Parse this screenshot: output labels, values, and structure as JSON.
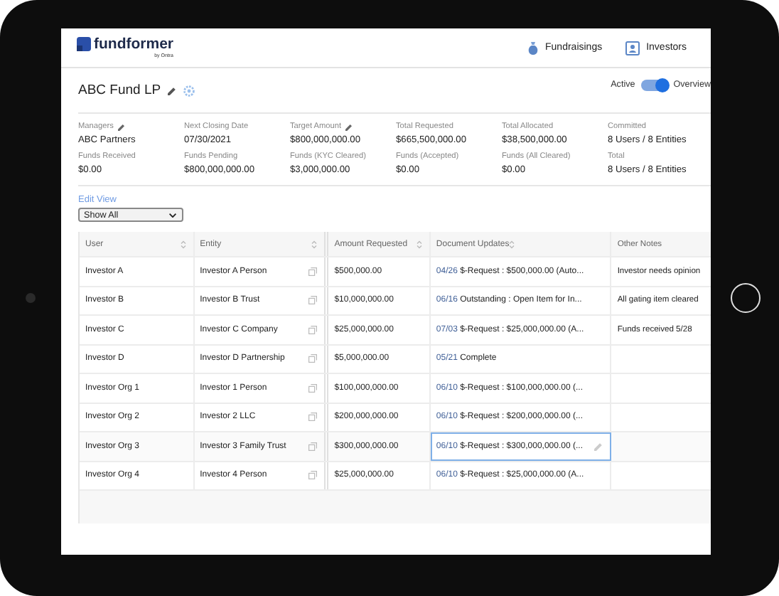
{
  "header": {
    "logo": {
      "name": "fundformer",
      "byline": "by Ontra"
    },
    "nav": [
      {
        "label": "Fundraisings",
        "kind": "bag"
      },
      {
        "label": "Investors",
        "kind": "contact"
      }
    ]
  },
  "fund": {
    "title": "ABC Fund LP",
    "toggle": {
      "label": "Active",
      "on": true
    },
    "view_label": "Overview"
  },
  "stats": [
    {
      "label": "Managers",
      "value": "ABC Partners",
      "editable": true
    },
    {
      "label": "Next Closing Date",
      "value": "07/30/2021",
      "editable": false
    },
    {
      "label": "Target Amount",
      "value": "$800,000,000.00",
      "editable": true
    },
    {
      "label": "Total Requested",
      "value": "$665,500,000.00",
      "editable": false
    },
    {
      "label": "Total Allocated",
      "value": "$38,500,000.00",
      "editable": false
    },
    {
      "label": "Committed",
      "value": "8 Users / 8 Entities",
      "editable": false
    },
    {
      "label": "Funds Received",
      "value": "$0.00",
      "editable": false
    },
    {
      "label": "Funds Pending",
      "value": "$800,000,000.00",
      "editable": false
    },
    {
      "label": "Funds (KYC Cleared)",
      "value": "$3,000,000.00",
      "editable": false
    },
    {
      "label": "Funds (Accepted)",
      "value": "$0.00",
      "editable": false
    },
    {
      "label": "Funds (All Cleared)",
      "value": "$0.00",
      "editable": false
    },
    {
      "label": "Total",
      "value": "8 Users / 8 Entities",
      "editable": false
    }
  ],
  "view": {
    "edit_link": "Edit View",
    "select": "Show All"
  },
  "table": {
    "columns": [
      {
        "label": "User",
        "sortable": true
      },
      {
        "label": "Entity",
        "sortable": true
      },
      {
        "label": "Amount Requested",
        "sortable": true
      },
      {
        "label": "Document Updates",
        "sortable": true
      },
      {
        "label": "Other Notes",
        "sortable": false
      }
    ],
    "rows": [
      {
        "user": "Investor A",
        "entity": "Investor A Person",
        "amount": "$500,000.00",
        "doc_date": "04/26",
        "doc_text": "$-Request : $500,000.00 (Auto...",
        "notes": "Investor needs opinion",
        "selected": false
      },
      {
        "user": "Investor B",
        "entity": "Investor B Trust",
        "amount": "$10,000,000.00",
        "doc_date": "06/16",
        "doc_text": "Outstanding : Open Item for In...",
        "notes": "All gating item cleared",
        "selected": false
      },
      {
        "user": "Investor C",
        "entity": "Investor C Company",
        "amount": "$25,000,000.00",
        "doc_date": "07/03",
        "doc_text": "$-Request : $25,000,000.00 (A...",
        "notes": "Funds received 5/28",
        "selected": false
      },
      {
        "user": "Investor D",
        "entity": "Investor D Partnership",
        "amount": "$5,000,000.00",
        "doc_date": "05/21",
        "doc_text": "Complete",
        "notes": "",
        "selected": false
      },
      {
        "user": "Investor Org 1",
        "entity": "Investor 1 Person",
        "amount": "$100,000,000.00",
        "doc_date": "06/10",
        "doc_text": "$-Request : $100,000,000.00 (...",
        "notes": "",
        "selected": false
      },
      {
        "user": "Investor Org 2",
        "entity": "Investor 2 LLC",
        "amount": "$200,000,000.00",
        "doc_date": "06/10",
        "doc_text": "$-Request : $200,000,000.00 (...",
        "notes": "",
        "selected": false
      },
      {
        "user": "Investor Org 3",
        "entity": "Investor 3 Family Trust",
        "amount": "$300,000,000.00",
        "doc_date": "06/10",
        "doc_text": "$-Request : $300,000,000.00 (...",
        "notes": "",
        "selected": true
      },
      {
        "user": "Investor Org 4",
        "entity": "Investor 4 Person",
        "amount": "$25,000,000.00",
        "doc_date": "06/10",
        "doc_text": "$-Request : $25,000,000.00 (A...",
        "notes": "",
        "selected": false
      }
    ]
  }
}
